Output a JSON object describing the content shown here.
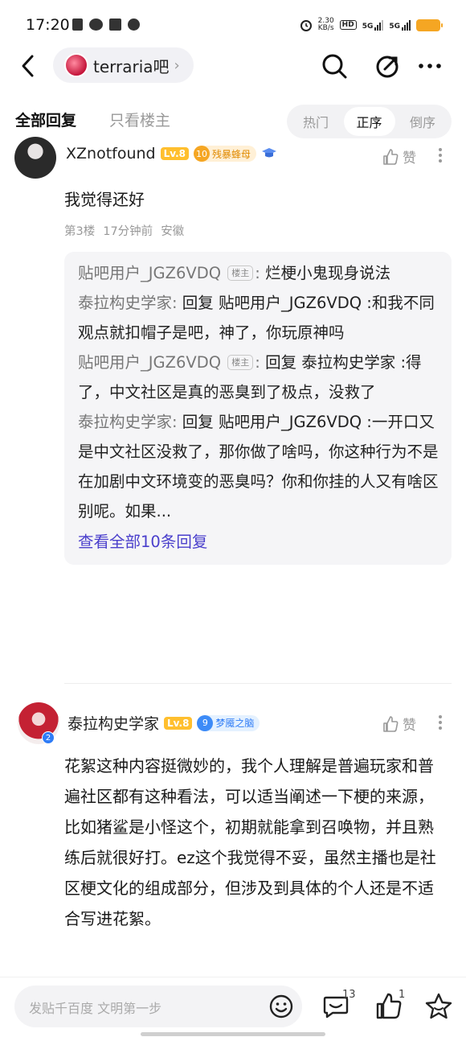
{
  "status_bar": {
    "time": "17:20",
    "net_speed_value": "2.30",
    "net_speed_unit": "KB/s",
    "hd_label": "HD",
    "sig1_label": "5G",
    "sig2_label": "5G"
  },
  "nav": {
    "forum_name": "terraria吧"
  },
  "tabs": {
    "all_replies": "全部回复",
    "op_only": "只看楼主",
    "sort": [
      "热门",
      "正序",
      "倒序"
    ],
    "sort_active_index": 1
  },
  "posts": [
    {
      "username": "XZnotfound",
      "level": "Lv.8",
      "title_num": "10",
      "title_name": "残暴蜂母",
      "like_label": "赞",
      "text": "我觉得还好",
      "floor": "第3楼",
      "time": "17分钟前",
      "location": "安徽",
      "replies": [
        {
          "name": "贴吧用户_JGZ6VDQ",
          "is_op": true,
          "op_tag": "楼主",
          "sep": ":",
          "text": " 烂梗小鬼现身说法"
        },
        {
          "name": "泰拉构史学家",
          "is_op": false,
          "sep": ":",
          "text": " 回复 贴吧用户_JGZ6VDQ :和我不同观点就扣帽子是吧，神了，你玩原神吗"
        },
        {
          "name": "贴吧用户_JGZ6VDQ",
          "is_op": true,
          "op_tag": "楼主",
          "sep": ":",
          "text": " 回复 泰拉构史学家 :得了，中文社区是真的恶臭到了极点，没救了"
        },
        {
          "name": "泰拉构史学家",
          "is_op": false,
          "sep": ":",
          "text": " 回复 贴吧用户_JGZ6VDQ :一开口又是中文社区没救了，那你做了啥吗，你这种行为不是在加剧中文环境变的恶臭吗？你和你挂的人又有啥区别呢。如果..."
        }
      ],
      "view_all": "查看全部10条回复"
    },
    {
      "username": "泰拉构史学家",
      "level": "Lv.8",
      "title_num": "9",
      "title_name": "梦魇之脑",
      "avatar_badge": "2",
      "like_label": "赞",
      "text": "花絮这种内容挺微妙的，我个人理解是普遍玩家和普遍社区都有这种看法，可以适当阐述一下梗的来源，比如猪鲨是小怪这个，初期就能拿到召唤物，并且熟练后就很好打。ez这个我觉得不妥，虽然主播也是社区梗文化的组成部分，但涉及到具体的个人还是不适合写进花絮。"
    }
  ],
  "bottom_bar": {
    "input_placeholder": "发贴千百度 文明第一步",
    "comment_count": "13",
    "like_count": "1"
  },
  "colors": {
    "accent_link": "#4a3fcc",
    "level_badge": "#ffbf2e",
    "battery": "#f5a623"
  }
}
